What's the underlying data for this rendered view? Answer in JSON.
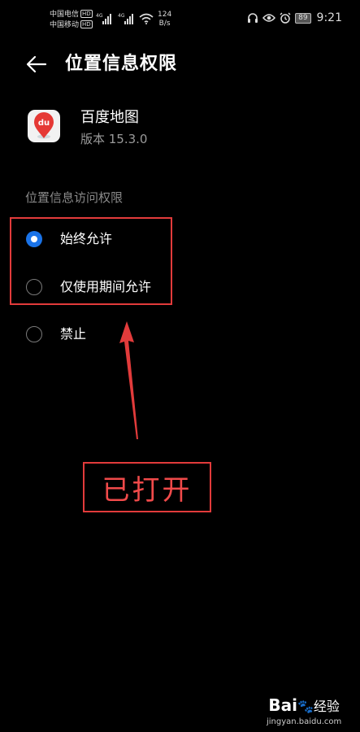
{
  "status_bar": {
    "carrier_1": "中国电信",
    "carrier_2": "中国移动",
    "hd_badge": "HD",
    "network_type": "4G",
    "speed_value": "124",
    "speed_unit": "B/s",
    "battery": "89",
    "time": "9:21"
  },
  "header": {
    "title": "位置信息权限"
  },
  "app": {
    "name": "百度地图",
    "version": "版本 15.3.0",
    "icon_text": "du"
  },
  "section": {
    "label": "位置信息访问权限"
  },
  "options": [
    {
      "label": "始终允许",
      "selected": true
    },
    {
      "label": "仅使用期间允许",
      "selected": false
    },
    {
      "label": "禁止",
      "selected": false
    }
  ],
  "annotation": {
    "callout_text": "已打开",
    "color": "#e23b3b"
  },
  "watermark": {
    "logo_text": "Bai",
    "logo_suffix": "经验",
    "url": "jingyan.baidu.com"
  },
  "colors": {
    "background": "#000000",
    "accent": "#1a73e8"
  }
}
